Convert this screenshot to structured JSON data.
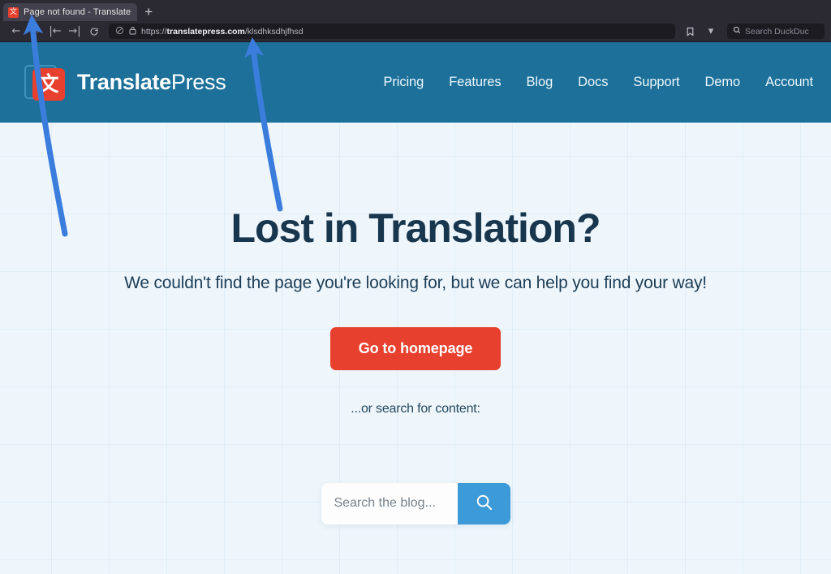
{
  "browser": {
    "tab": {
      "title": "Page not found - Translate",
      "favicon_icon": "translatepress-favicon-icon"
    },
    "new_tab_label": "+",
    "nav": {
      "back_icon": "←",
      "forward_icon": "→",
      "home_left_icon": "|←",
      "home_right_icon": "→|",
      "reload_icon": "⟳"
    },
    "url": {
      "shield_icon": "⊘",
      "lock_icon": "🔒",
      "scheme": "https://",
      "domain": "translatepress.com",
      "path": "/klsdhksdhjfhsd"
    },
    "toolbar_right": {
      "bookmark_icon": "bookmark-icon",
      "chevron_icon": "▾",
      "search_engine_icon": "duckduckgo-search-icon",
      "search_placeholder": "Search DuckDuc"
    }
  },
  "site": {
    "brand": {
      "glyph": "文",
      "name_bold": "Translate",
      "name_light": "Press"
    },
    "nav_items": [
      {
        "label": "Pricing"
      },
      {
        "label": "Features"
      },
      {
        "label": "Blog"
      },
      {
        "label": "Docs"
      },
      {
        "label": "Support"
      },
      {
        "label": "Demo"
      },
      {
        "label": "Account"
      }
    ]
  },
  "hero": {
    "heading": "Lost in Translation?",
    "subheading": "We couldn't find the page you're looking for, but we can help you find your way!",
    "cta_label": "Go to homepage",
    "or_search_label": "...or search for content:",
    "search_placeholder": "Search the blog...",
    "search_value": "",
    "search_button_icon": "magnifier-icon"
  },
  "colors": {
    "header_blue": "#1c7099",
    "accent_red": "#e8402f",
    "search_button_blue": "#3d9ad8",
    "heading_navy": "#18364d",
    "page_background": "#eef6fb",
    "annotation_blue": "#3b7ddd"
  },
  "annotations": [
    {
      "name": "arrow-to-tab-title",
      "target": "tab-title"
    },
    {
      "name": "arrow-to-url-bar",
      "target": "url-bar"
    }
  ]
}
